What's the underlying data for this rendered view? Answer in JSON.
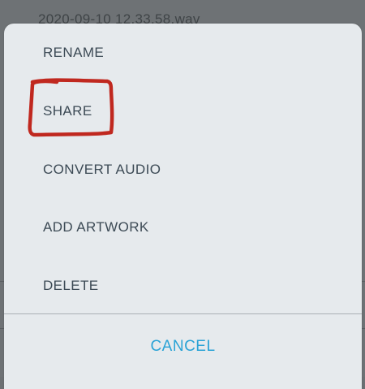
{
  "background": {
    "filename": "2020-09-10 12.33.58.wav"
  },
  "action_sheet": {
    "items": [
      {
        "label": "RENAME"
      },
      {
        "label": "SHARE"
      },
      {
        "label": "CONVERT AUDIO"
      },
      {
        "label": "ADD ARTWORK"
      },
      {
        "label": "DELETE"
      }
    ],
    "cancel_label": "CANCEL"
  },
  "colors": {
    "sheet_background": "#e6eaed",
    "item_text": "#3c4a55",
    "cancel_text": "#2aa3d6",
    "annotation_stroke": "#c0281f",
    "dim_overlay": "#6e7275"
  },
  "annotation": {
    "shape": "hand-drawn rectangle",
    "target": "SHARE"
  }
}
